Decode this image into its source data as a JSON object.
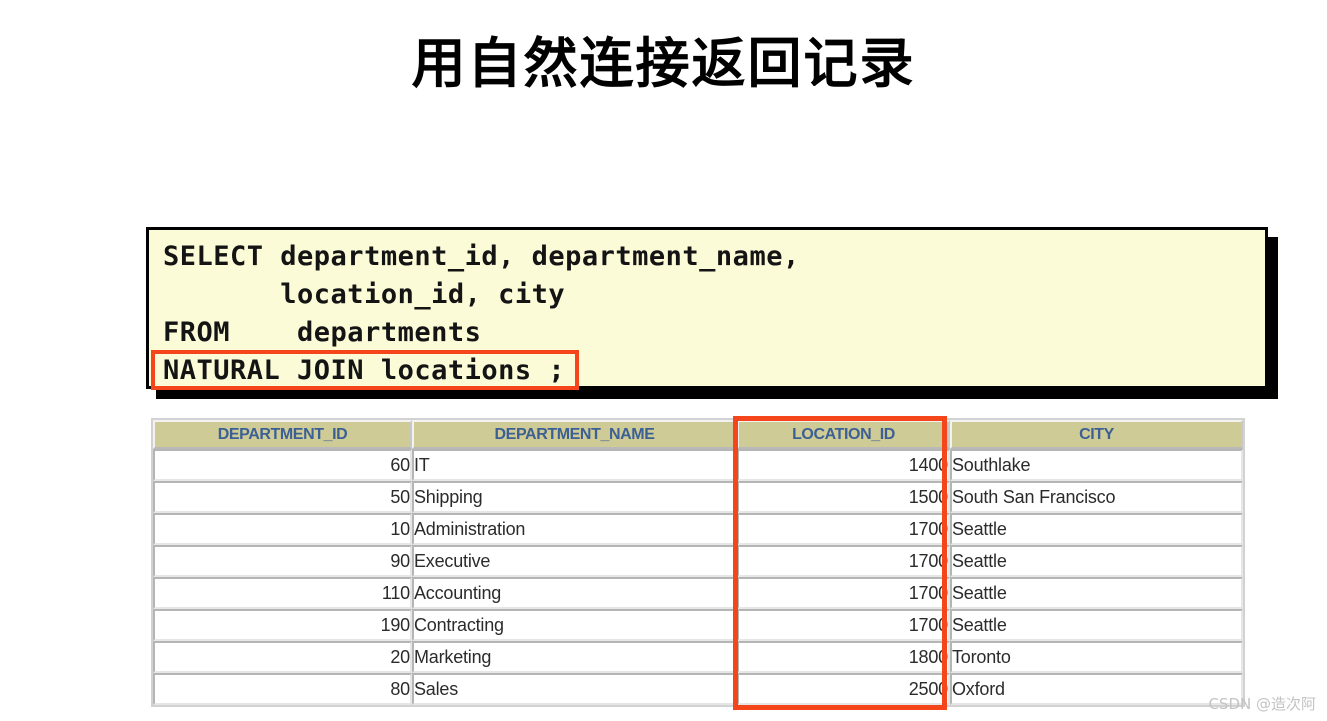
{
  "slide": {
    "title": "用自然连接返回记录"
  },
  "code_block": {
    "lines": [
      "SELECT department_id, department_name,",
      "       location_id, city",
      "FROM    departments",
      "NATURAL JOIN locations ;"
    ],
    "highlight_text": "NATURAL JOIN locations",
    "background_color": "#fcfbd8",
    "border_color": "#000000",
    "highlight_color": "#f4451b"
  },
  "result_table": {
    "columns": [
      "DEPARTMENT_ID",
      "DEPARTMENT_NAME",
      "LOCATION_ID",
      "CITY"
    ],
    "rows": [
      {
        "department_id": "60",
        "department_name": "IT",
        "location_id": "1400",
        "city": "Southlake"
      },
      {
        "department_id": "50",
        "department_name": "Shipping",
        "location_id": "1500",
        "city": "South San Francisco"
      },
      {
        "department_id": "10",
        "department_name": "Administration",
        "location_id": "1700",
        "city": "Seattle"
      },
      {
        "department_id": "90",
        "department_name": "Executive",
        "location_id": "1700",
        "city": "Seattle"
      },
      {
        "department_id": "110",
        "department_name": "Accounting",
        "location_id": "1700",
        "city": "Seattle"
      },
      {
        "department_id": "190",
        "department_name": "Contracting",
        "location_id": "1700",
        "city": "Seattle"
      },
      {
        "department_id": "20",
        "department_name": "Marketing",
        "location_id": "1800",
        "city": "Toronto"
      },
      {
        "department_id": "80",
        "department_name": "Sales",
        "location_id": "2500",
        "city": "Oxford"
      }
    ],
    "highlighted_column": "LOCATION_ID",
    "header_background_color": "#cfcb96",
    "header_text_color": "#3c6094",
    "highlight_color": "#f4451b"
  },
  "watermark": {
    "text": "CSDN @造次阿"
  }
}
